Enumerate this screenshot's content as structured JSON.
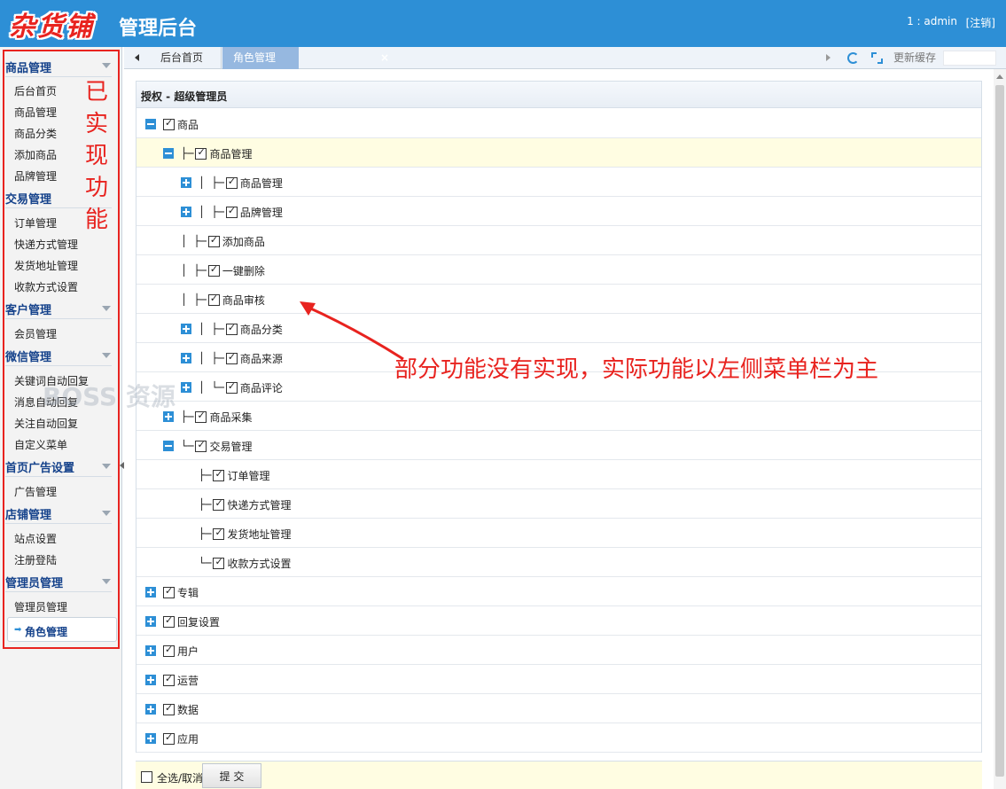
{
  "header": {
    "logo": "杂货铺",
    "title": "管理后台",
    "user": "1 : admin",
    "logout": "[注销]"
  },
  "sidebar": {
    "groups": [
      {
        "title": "商品管理",
        "items": [
          "后台首页",
          "商品管理",
          "商品分类",
          "添加商品",
          "品牌管理"
        ]
      },
      {
        "title": "交易管理",
        "items": [
          "订单管理",
          "快递方式管理",
          "发货地址管理",
          "收款方式设置"
        ]
      },
      {
        "title": "客户管理",
        "items": [
          "会员管理"
        ]
      },
      {
        "title": "微信管理",
        "items": [
          "关键词自动回复",
          "消息自动回复",
          "关注自动回复",
          "自定义菜单"
        ]
      },
      {
        "title": "首页广告设置",
        "items": [
          "广告管理"
        ]
      },
      {
        "title": "店铺管理",
        "items": [
          "站点设置",
          "注册登陆"
        ]
      },
      {
        "title": "管理员管理",
        "items": [
          "管理员管理"
        ]
      }
    ],
    "active_item": "角色管理",
    "note": [
      "已",
      "实",
      "现",
      "功",
      "能"
    ]
  },
  "tabs": {
    "items": [
      "后台首页",
      "角色管理"
    ],
    "active": "角色管理",
    "close_glyph": "×",
    "update_cache": "更新缓存"
  },
  "panel": {
    "title": "授权 - 超级管理员",
    "tree": [
      {
        "label": "商品",
        "checked": true,
        "expander": "minus"
      },
      {
        "label": "商品管理",
        "checked": true,
        "expander": "minus",
        "connector": "├─",
        "highlight": true
      },
      {
        "label": "商品管理",
        "checked": true,
        "expander": "plus",
        "connector": "│  ├─"
      },
      {
        "label": "品牌管理",
        "checked": true,
        "expander": "plus",
        "connector": "│  ├─"
      },
      {
        "label": "添加商品",
        "checked": true,
        "expander": "",
        "connector": "│  ├─"
      },
      {
        "label": "一键删除",
        "checked": true,
        "expander": "",
        "connector": "│  ├─"
      },
      {
        "label": "商品审核",
        "checked": true,
        "expander": "",
        "connector": "│  ├─"
      },
      {
        "label": "商品分类",
        "checked": true,
        "expander": "plus",
        "connector": "│  ├─"
      },
      {
        "label": "商品来源",
        "checked": true,
        "expander": "plus",
        "connector": "│  ├─"
      },
      {
        "label": "商品评论",
        "checked": true,
        "expander": "plus",
        "connector": "│  └─"
      },
      {
        "label": "商品采集",
        "checked": true,
        "expander": "plus",
        "connector": "├─"
      },
      {
        "label": "交易管理",
        "checked": true,
        "expander": "minus",
        "connector": "└─"
      },
      {
        "label": "订单管理",
        "checked": true,
        "expander": "",
        "connector": "├─"
      },
      {
        "label": "快递方式管理",
        "checked": true,
        "expander": "",
        "connector": "├─"
      },
      {
        "label": "发货地址管理",
        "checked": true,
        "expander": "",
        "connector": "├─"
      },
      {
        "label": "收款方式设置",
        "checked": true,
        "expander": "",
        "connector": "└─"
      },
      {
        "label": "专辑",
        "checked": true,
        "expander": "plus"
      },
      {
        "label": "回复设置",
        "checked": true,
        "expander": "plus"
      },
      {
        "label": "用户",
        "checked": true,
        "expander": "plus"
      },
      {
        "label": "运营",
        "checked": true,
        "expander": "plus"
      },
      {
        "label": "数据",
        "checked": true,
        "expander": "plus"
      },
      {
        "label": "应用",
        "checked": true,
        "expander": "plus"
      }
    ]
  },
  "footer": {
    "select_all": "全选/取消",
    "submit": "提 交"
  },
  "annotation": {
    "text": "部分功能没有实现，实际功能以左侧菜单栏为主"
  },
  "watermark": "BOSS 资源",
  "colors": {
    "header_bg": "#2d8fd6",
    "accent_red": "#e8231f",
    "active_tab": "#96b8e0",
    "highlight_row": "#fffde2",
    "nav_text": "#15428b"
  }
}
